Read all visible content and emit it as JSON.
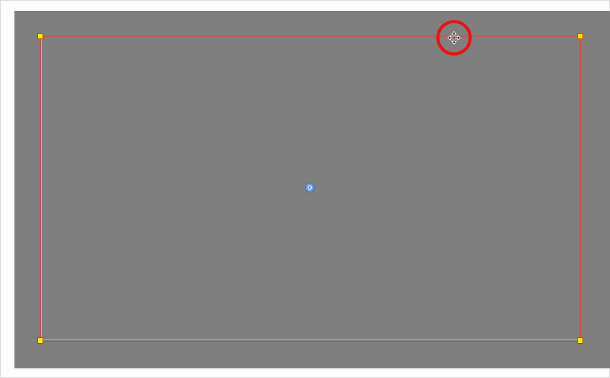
{
  "colors": {
    "canvas_background": "#7f7f7f",
    "bounding_box": "#ff2a1a",
    "bounding_box_inner": "#ffb020",
    "handle_fill": "#ffe21a",
    "pivot_fill": "#6f9de0",
    "highlight_ring": "#ee1111"
  },
  "icons": {
    "cursor": "move-cursor-icon",
    "pivot": "pivot-point-icon",
    "handle": "resize-handle-icon"
  }
}
